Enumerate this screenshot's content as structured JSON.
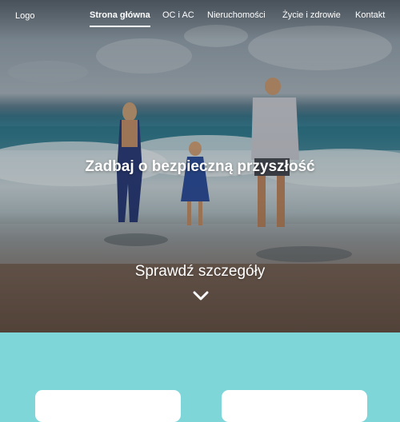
{
  "nav": {
    "logo": "Logo",
    "items": [
      {
        "label": "Strona główna",
        "active": true
      },
      {
        "label": "OC i AC",
        "active": false
      },
      {
        "label": "Nieruchomości",
        "active": false
      },
      {
        "label": "Życie i zdrowie",
        "active": false
      },
      {
        "label": "Kontakt",
        "active": false
      }
    ]
  },
  "hero": {
    "title": "Zadbaj o bezpieczną przyszłość",
    "cta_label": "Sprawdź szczegóły",
    "cta_icon": "chevron-down-icon"
  },
  "colors": {
    "section_background": "#7fd6d9",
    "card_background": "#ffffff",
    "text": "#ffffff"
  }
}
